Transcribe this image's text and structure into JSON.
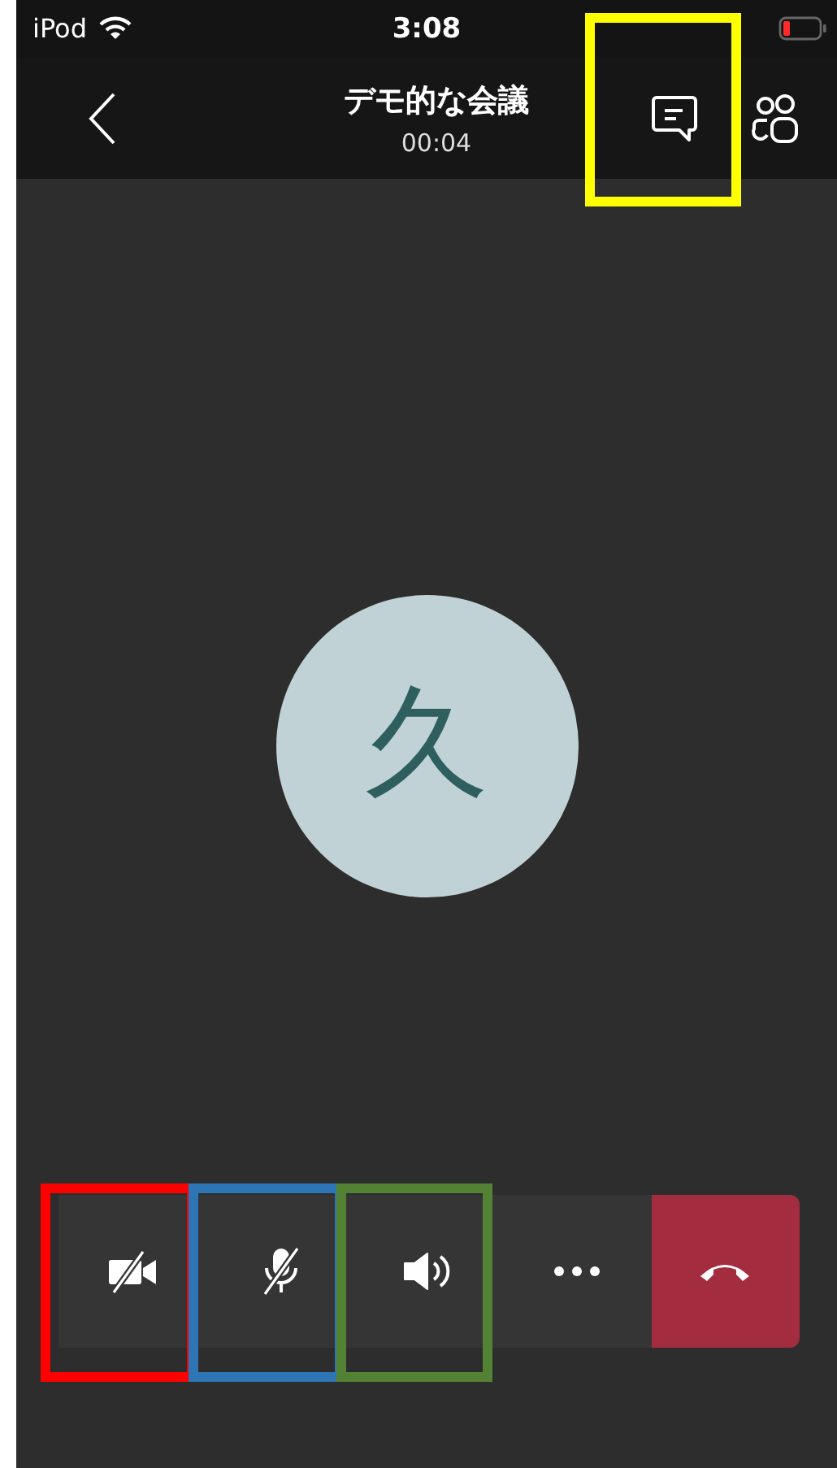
{
  "status_bar": {
    "carrier": "iPod",
    "time": "3:08"
  },
  "header": {
    "title": "デモ的な会議",
    "duration": "00:04",
    "chat_highlight": {
      "color": "#ffff00"
    }
  },
  "participant": {
    "initial": "久"
  },
  "controls": [
    {
      "kind": "video",
      "on": false,
      "highlight": {
        "color": "#ff0000"
      }
    },
    {
      "kind": "mic",
      "on": false,
      "highlight": {
        "color": "#2e75b6"
      }
    },
    {
      "kind": "speaker",
      "on": true,
      "highlight": {
        "color": "#548235"
      }
    },
    {
      "kind": "more"
    },
    {
      "kind": "hangup"
    }
  ]
}
